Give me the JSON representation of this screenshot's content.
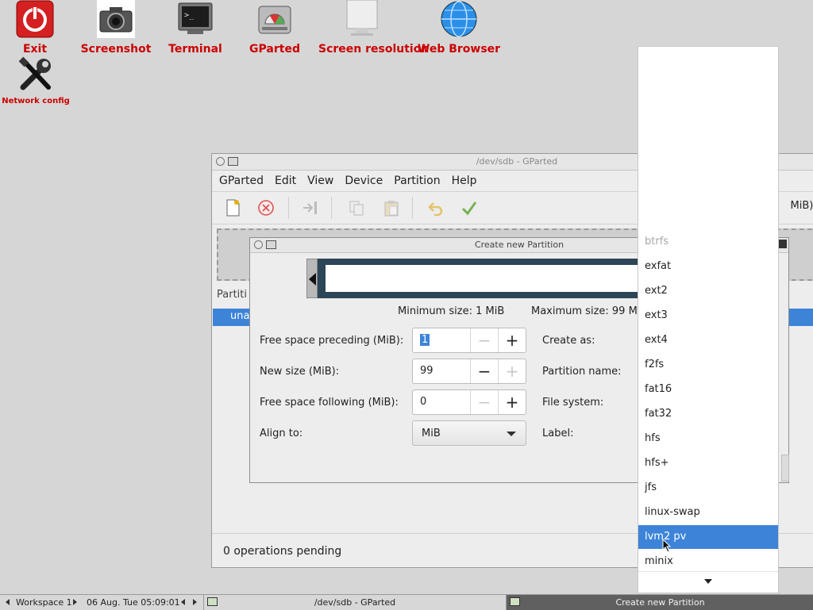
{
  "desktop": {
    "icons": [
      {
        "label": "Exit"
      },
      {
        "label": "Screenshot"
      },
      {
        "label": "Terminal"
      },
      {
        "label": "GParted"
      },
      {
        "label": "Screen resolution"
      },
      {
        "label": "Web Browser"
      },
      {
        "label": "Network config"
      }
    ]
  },
  "main_window": {
    "title": "/dev/sdb - GParted",
    "menu": [
      "GParted",
      "Edit",
      "View",
      "Device",
      "Partition",
      "Help"
    ],
    "device_selector": "MiB)",
    "partition_header": "Partiti",
    "partition_row": "una",
    "status": "0 operations pending"
  },
  "dialog": {
    "title": "Create new Partition",
    "min_size": "Minimum size: 1 MiB",
    "max_size": "Maximum size: 99 MiB",
    "fields": {
      "free_preceding_label": "Free space preceding (MiB):",
      "free_preceding_value": "1",
      "new_size_label": "New size (MiB):",
      "new_size_value": "99",
      "free_following_label": "Free space following (MiB):",
      "free_following_value": "0",
      "align_label": "Align to:",
      "align_value": "MiB",
      "create_as_label": "Create as:",
      "partition_name_label": "Partition name:",
      "file_system_label": "File system:",
      "label_label": "Label:"
    }
  },
  "filesystem_dropdown": {
    "items": [
      {
        "label": "btrfs",
        "state": "disabled"
      },
      {
        "label": "exfat",
        "state": "normal"
      },
      {
        "label": "ext2",
        "state": "normal"
      },
      {
        "label": "ext3",
        "state": "normal"
      },
      {
        "label": "ext4",
        "state": "normal"
      },
      {
        "label": "f2fs",
        "state": "normal"
      },
      {
        "label": "fat16",
        "state": "normal"
      },
      {
        "label": "fat32",
        "state": "normal"
      },
      {
        "label": "hfs",
        "state": "normal"
      },
      {
        "label": "hfs+",
        "state": "normal"
      },
      {
        "label": "jfs",
        "state": "normal"
      },
      {
        "label": "linux-swap",
        "state": "normal"
      },
      {
        "label": "lvm2 pv",
        "state": "highlighted"
      },
      {
        "label": "minix",
        "state": "normal"
      }
    ]
  },
  "taskbar": {
    "workspace": "Workspace 1",
    "clock": "06 Aug. Tue 05:09:01",
    "tasks": [
      "/dev/sdb - GParted",
      "Create new Partition"
    ]
  },
  "colors": {
    "desktop_label": "#cc0000",
    "selection": "#3d84d8",
    "partition_bar": "#2c4557"
  }
}
